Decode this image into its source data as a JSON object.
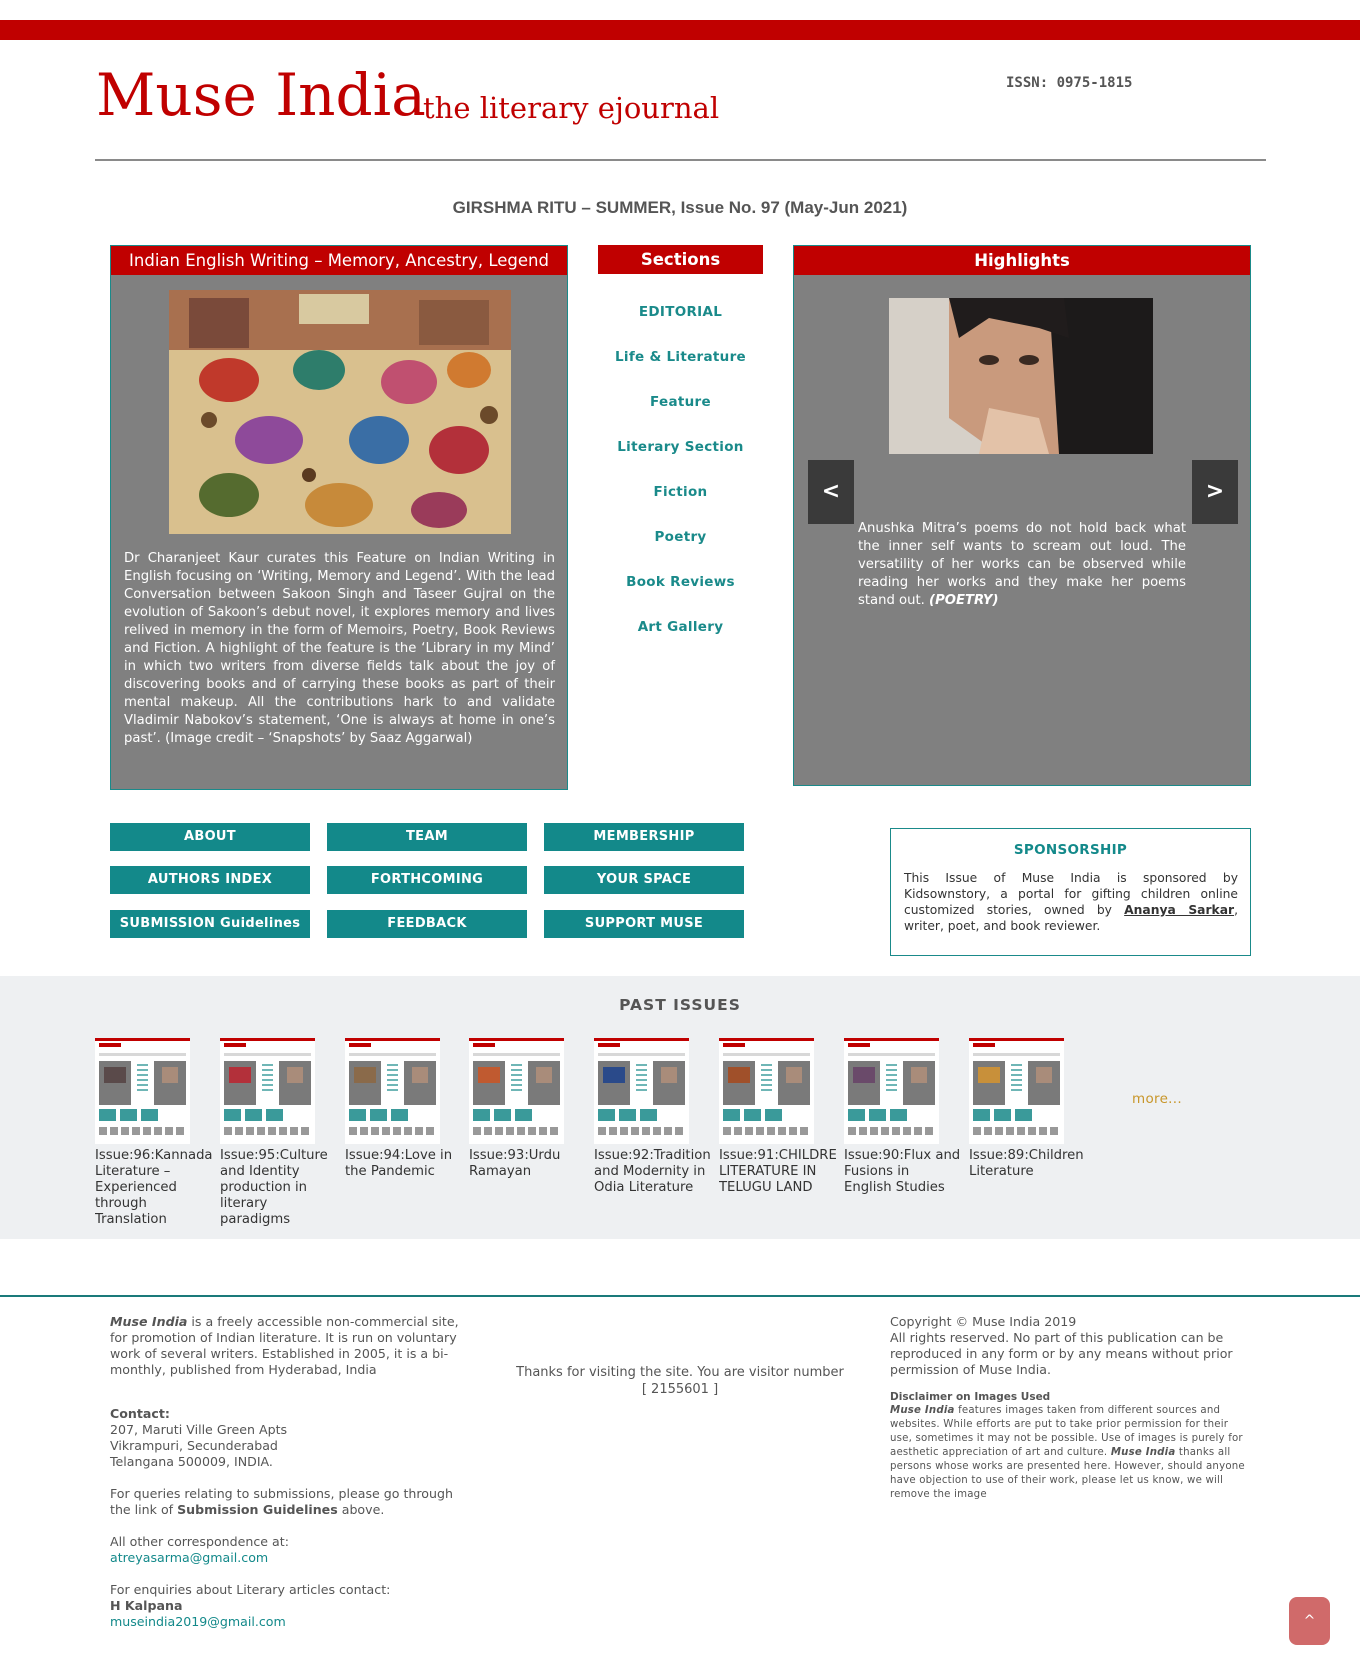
{
  "header": {
    "logo": "Muse India",
    "tagline": "the literary ejournal",
    "issn": "ISSN: 0975-1815"
  },
  "issue_title": "GIRSHMA RITU – SUMMER, Issue No. 97 (May-Jun 2021)",
  "feature": {
    "title": "Indian English Writing – Memory, Ancestry, Legend",
    "image_alt": "Snapshots by Saaz Aggarwal",
    "text": "Dr Charanjeet Kaur curates this Feature on Indian Writing in English focusing on ‘Writing, Memory and Legend’. With the lead Conversation between Sakoon Singh and Taseer Gujral on the evolution of Sakoon’s debut novel, it explores memory and lives relived in memory in the form of Memoirs, Poetry, Book Reviews and Fiction. A highlight of the feature is the ‘Library in my Mind’ in which two writers from diverse fields talk about the joy of discovering books and of carrying these books as part of their mental makeup. All the contributions hark to and validate Vladimir Nabokov’s statement, ‘One is always at home in one’s past’. (Image credit – ‘Snapshots’ by Saaz Aggarwal)"
  },
  "sections": {
    "title": "Sections",
    "items": [
      "EDITORIAL",
      "Life & Literature",
      "Feature",
      "Literary Section",
      "Fiction",
      "Poetry",
      "Book Reviews",
      "Art Gallery"
    ]
  },
  "highlights": {
    "title": "Highlights",
    "prev": "<",
    "next": ">",
    "text": "Anushka Mitra’s poems do not hold back what the inner self wants to scream out loud. The versatility of her works can be observed while reading her works and they make her poems stand out.",
    "tag": "(POETRY)"
  },
  "buttons": [
    "ABOUT",
    "TEAM",
    "MEMBERSHIP",
    "AUTHORS INDEX",
    "FORTHCOMING",
    "YOUR SPACE",
    "SUBMISSION Guidelines",
    "FEEDBACK",
    "SUPPORT MUSE"
  ],
  "sponsorship": {
    "title": "SPONSORSHIP",
    "text_before": "This Issue of Muse India is sponsored by Kidsownstory, a portal for gifting children online customized stories, owned by",
    "owner": "Ananya Sarkar",
    "text_after": ", writer, poet, and book reviewer."
  },
  "past_issues": {
    "title": "PAST ISSUES",
    "items": [
      "Issue:96:Kannada Literature – Experienced through Translation",
      "Issue:95:Culture and Identity production in literary paradigms",
      "Issue:94:Love in the Pandemic",
      "Issue:93:Urdu Ramayan",
      "Issue:92:Tradition and Modernity in Odia Literature",
      "Issue:91:CHILDREN LITERATURE IN TELUGU LAND",
      "Issue:90:Flux and Fusions in English Studies",
      "Issue:89:Children Literature"
    ],
    "more": "more..."
  },
  "footer": {
    "about_name": "Muse India",
    "about_text": " is a freely accessible non-commercial site, for promotion of Indian literature. It is run on voluntary work of several writers. Established in 2005, it is a bi-monthly, published from Hyderabad, India",
    "contact_label": "Contact:",
    "address1": "207, Maruti Ville Green Apts",
    "address2": "Vikrampuri, Secunderabad",
    "address3": "Telangana 500009, INDIA.",
    "submissions_before": "For queries relating to submissions, please go through the link of ",
    "submissions_link": "Submission Guidelines",
    "submissions_after": " above.",
    "correspondence_label": "All other correspondence at:",
    "correspondence_email": "atreyasarma@gmail.com",
    "enquiries_label": "For enquiries about Literary articles contact:",
    "enquiries_name": "H Kalpana",
    "enquiries_email": "museindia2019@gmail.com",
    "visitor_text": "Thanks for visiting the site. You are visitor number",
    "visitor_count": "[ 2155601 ]",
    "copyright": "Copyright © Muse India 2019",
    "rights": "All rights reserved. No part of this publication can be reproduced in any form or by any means without prior permission of Muse India.",
    "disclaimer_title": "Disclaimer on Images Used",
    "disclaimer_name": "Muse India",
    "disclaimer_text1": " features images taken from different sources and websites. While efforts are put to take prior permission for their use, sometimes it may not be possible. Use of images is purely for aesthetic appreciation of art and culture. ",
    "disclaimer_text2": " thanks all persons whose works are presented here. However, should anyone have objection to use of their work, please let us know, we will remove the image",
    "back_to_top": "^"
  }
}
